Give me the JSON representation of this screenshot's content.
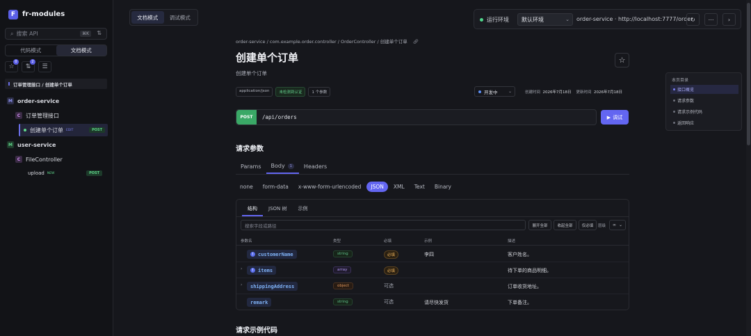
{
  "app": {
    "logo_letter": "F",
    "name": "fr-modules"
  },
  "sidebar": {
    "search_placeholder": "搜索 API",
    "search_kbd": "⌘K",
    "modes": [
      "代码模式",
      "文档模式"
    ],
    "active_mode": 1,
    "icon_badges": [
      "0",
      "2"
    ],
    "breadcrumb": "订单管理接口 / 创建单个订单",
    "tree": [
      {
        "badge": "M",
        "label": "order-service"
      },
      {
        "badge": "C",
        "label": "订单管理接口"
      },
      {
        "label": "创建单个订单",
        "mini": "EDIT",
        "method": "POST"
      },
      {
        "badge": "M",
        "label": "user-service"
      },
      {
        "badge": "C",
        "label": "FileController"
      },
      {
        "label": "upload",
        "mini": "NEW",
        "method": "POST"
      }
    ]
  },
  "topbar": {
    "segments": [
      "文档模式",
      "调试模式"
    ],
    "env_label": "运行环境",
    "env_value": "默认环境",
    "env_url": "order-service · http://localhost:7777/order"
  },
  "doc": {
    "breadcrumb": "order-service  /  com.example.order.controller  /  OrderController  /  创建单个订单",
    "title": "创建单个订单",
    "subtitle": "创建单个订单",
    "tags": [
      "application/json",
      "未检测到认证",
      "1 个参数"
    ],
    "status": "开发中",
    "created_label": "创建时间",
    "created": "2026年7月18日",
    "updated_label": "更新时间",
    "updated": "2026年7月18日",
    "method": "POST",
    "path": "/api/orders",
    "debug_label": "调试"
  },
  "toc": {
    "heading": "本页目录",
    "items": [
      "接口概览",
      "请求参数",
      "请求示例代码",
      "返回响应"
    ],
    "active": 0
  },
  "params": {
    "section_title": "请求参数",
    "tabs": [
      "Params",
      "Body",
      "Headers"
    ],
    "body_count": "1",
    "formats": [
      "none",
      "form-data",
      "x-www-form-urlencoded",
      "JSON",
      "XML",
      "Text",
      "Binary"
    ],
    "panel_tabs": [
      "结构",
      "JSON 树",
      "示例"
    ],
    "field_search_placeholder": "搜索字段或路径",
    "btn_expand": "展开全部",
    "btn_collapse": "收起全部",
    "btn_required": "仅必填",
    "level_label": "层级",
    "level_value": "∞",
    "columns": [
      "参数名",
      "类型",
      "必填",
      "示例",
      "描述"
    ],
    "rows": [
      {
        "name": "customerName",
        "type": "string",
        "required": "必填",
        "req": true,
        "example": "李四",
        "desc": "客户姓名。",
        "expand": false
      },
      {
        "name": "items",
        "type": "array",
        "required": "必填",
        "req": true,
        "example": "",
        "desc": "待下单的商品明细。",
        "expand": true
      },
      {
        "name": "shippingAddress",
        "type": "object",
        "required": "可选",
        "req": false,
        "example": "",
        "desc": "订单收货地址。",
        "expand": true
      },
      {
        "name": "remark",
        "type": "string",
        "required": "可选",
        "req": false,
        "example": "请尽快发货",
        "desc": "下单备注。",
        "expand": false
      }
    ]
  },
  "sample_section_title": "请求示例代码"
}
